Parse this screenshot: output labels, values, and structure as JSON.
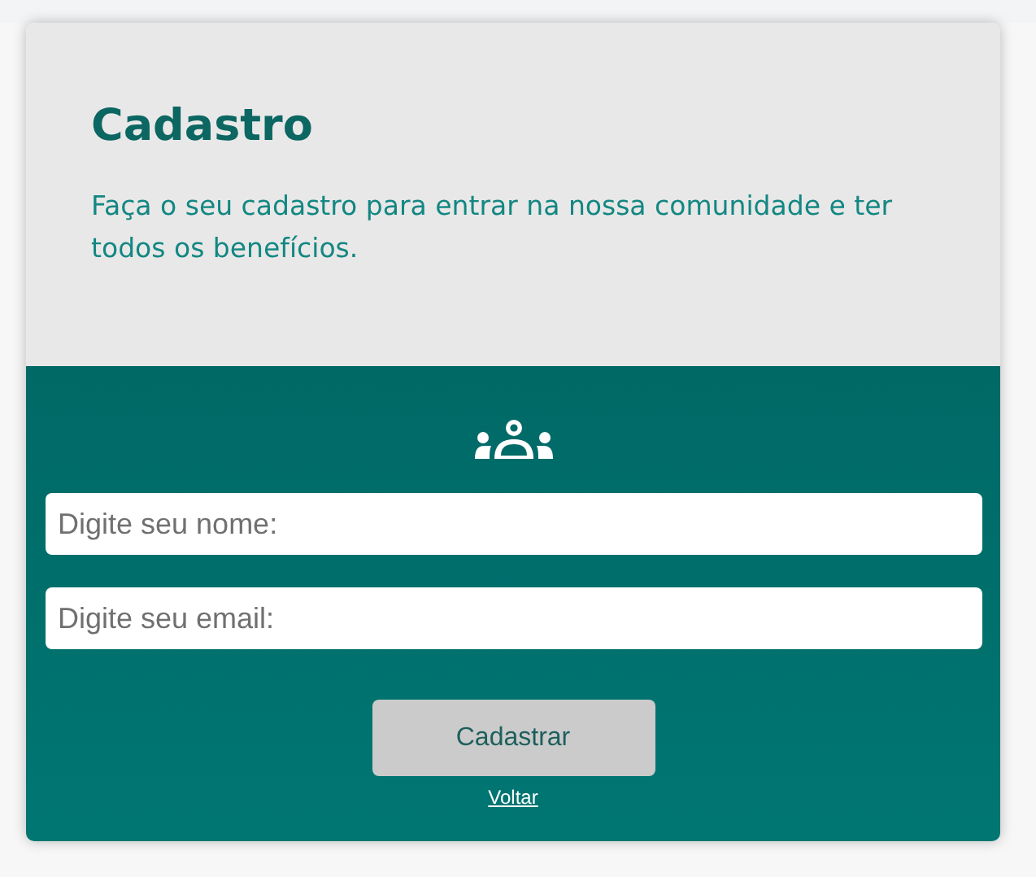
{
  "header": {
    "title": "Cadastro",
    "subtitle": "Faça o seu cadastro para entrar na nossa comunidade e ter todos os benefícios."
  },
  "form": {
    "fields": [
      {
        "placeholder": "Digite seu nome:"
      },
      {
        "placeholder": "Digite seu email:"
      }
    ],
    "submit": "Cadastrar",
    "back_link": "Voltar"
  }
}
